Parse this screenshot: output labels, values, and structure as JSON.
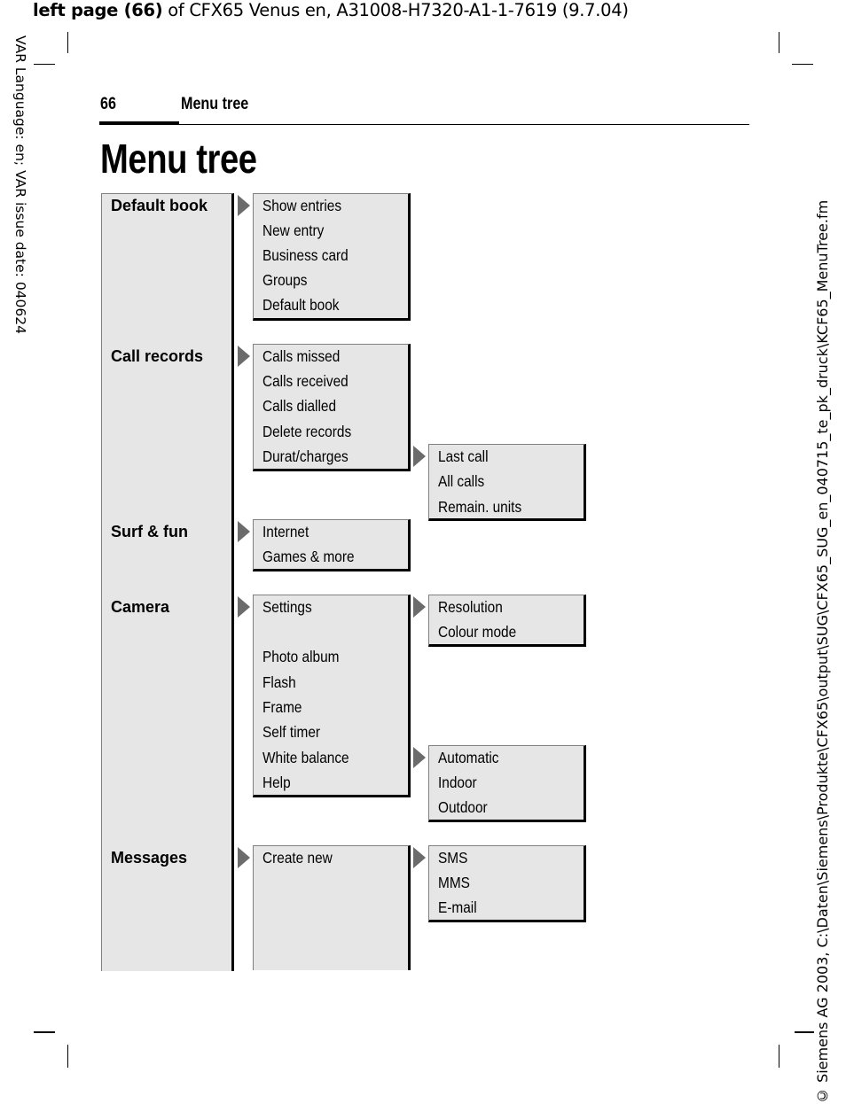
{
  "print_header": {
    "bold_part": "left page (66)",
    "rest": " of CFX65 Venus en, A31008-H7320-A1-1-7619 (9.7.04)"
  },
  "side_left": "VAR Language: en; VAR issue date: 040624",
  "side_right": "© Siemens AG 2003, C:\\Daten\\Siemens\\Produkte\\CFX65\\output\\SUG\\CFX65_SUG_en_040715_te_pk_druck\\KCF65_MenuTree.fm",
  "page_header": {
    "page_number": "66",
    "section": "Menu tree"
  },
  "title": "Menu tree",
  "menu": {
    "default_book": {
      "label": "Default book",
      "items": [
        "Show entries",
        "New entry",
        "Business card",
        "Groups",
        "Default book"
      ]
    },
    "call_records": {
      "label": "Call records",
      "items": [
        "Calls missed",
        "Calls received",
        "Calls dialled",
        "Delete records",
        "Durat/charges"
      ],
      "durat_charges_sub": [
        "Last call",
        "All calls",
        "Remain. units"
      ]
    },
    "surf_fun": {
      "label": "Surf & fun",
      "items": [
        "Internet",
        "Games & more"
      ]
    },
    "camera": {
      "label": "Camera",
      "items": [
        "Settings",
        "Photo album",
        "Flash",
        "Frame",
        "Self timer",
        "White balance",
        "Help"
      ],
      "settings_sub": [
        "Resolution",
        "Colour mode"
      ],
      "white_balance_sub": [
        "Automatic",
        "Indoor",
        "Outdoor"
      ]
    },
    "messages": {
      "label": "Messages",
      "items": [
        "Create new"
      ],
      "create_new_sub": [
        "SMS",
        "MMS",
        "E-mail"
      ]
    }
  }
}
